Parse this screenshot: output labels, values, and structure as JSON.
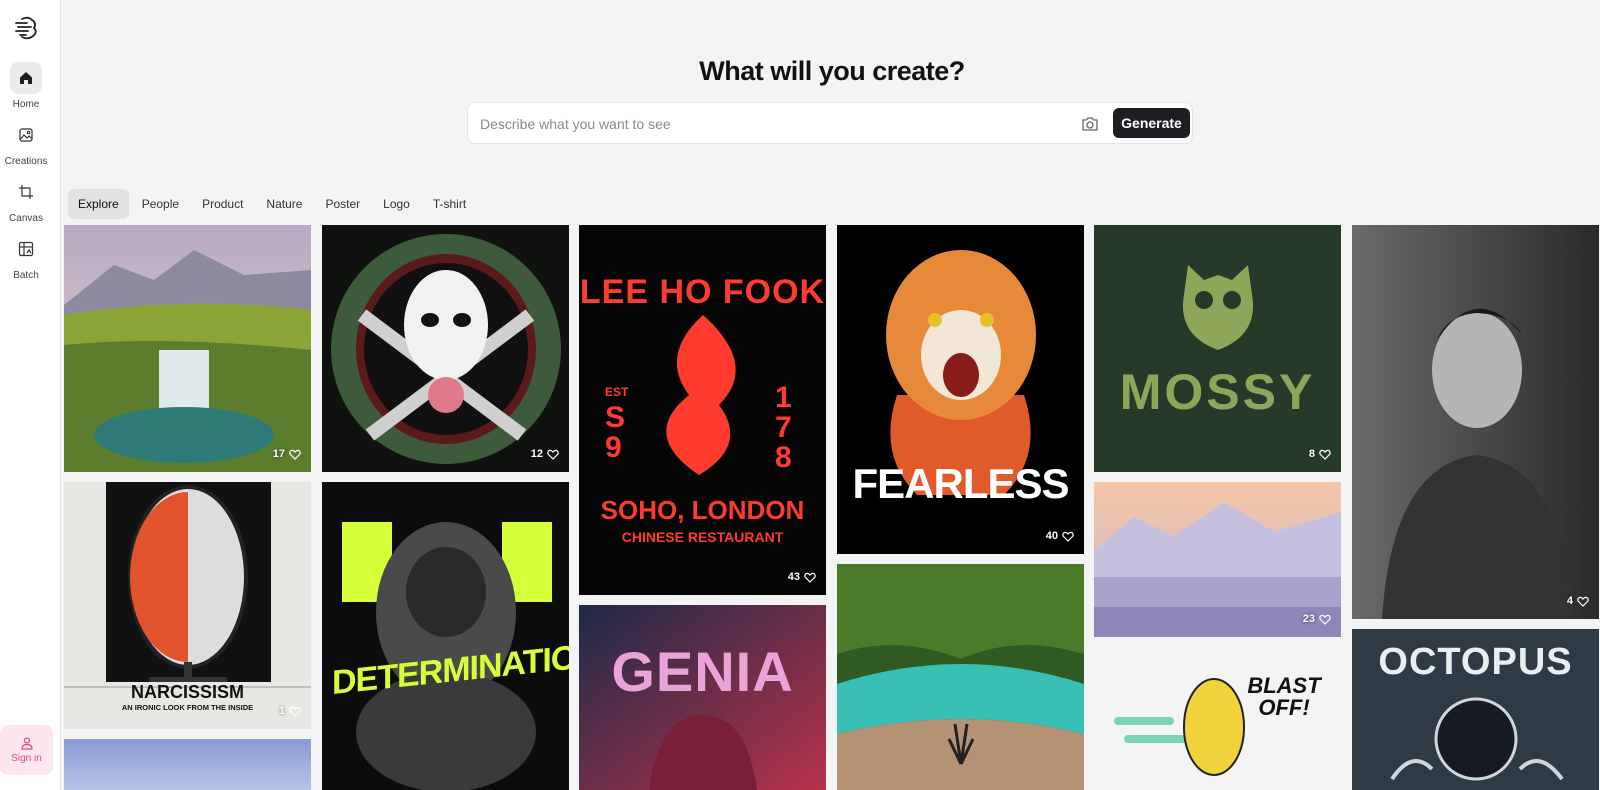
{
  "nav": {
    "home": "Home",
    "creations": "Creations",
    "canvas": "Canvas",
    "batch": "Batch",
    "signin": "Sign in"
  },
  "hero": {
    "title": "What will you create?",
    "placeholder": "Describe what you want to see",
    "generate": "Generate"
  },
  "tabs": [
    "Explore",
    "People",
    "Product",
    "Nature",
    "Poster",
    "Logo",
    "T-shirt"
  ],
  "cards": [
    {
      "likes": "17"
    },
    {
      "likes": "12"
    },
    {
      "likes": "43",
      "text_top": "LEE HO FOOK",
      "text_left": "EST",
      "text_left2": "S9",
      "text_right": "178",
      "text_bottom": "SOHO, LONDON",
      "text_bottom2": "CHINESE RESTAURANT"
    },
    {
      "likes": "40",
      "text": "FEARLESS"
    },
    {
      "likes": "8",
      "text": "MOSSY"
    },
    {
      "likes": "4"
    },
    {
      "likes": "1",
      "title": "NARCISSISM",
      "subtitle": "AN IRONIC LOOK FROM THE INSIDE"
    },
    {
      "text": "DETERMINATION"
    },
    {
      "text": "GENIA"
    },
    {},
    {
      "likes": "23"
    },
    {
      "text": "BLAST OFF!"
    },
    {
      "text": "OCTOPUS"
    },
    {}
  ]
}
